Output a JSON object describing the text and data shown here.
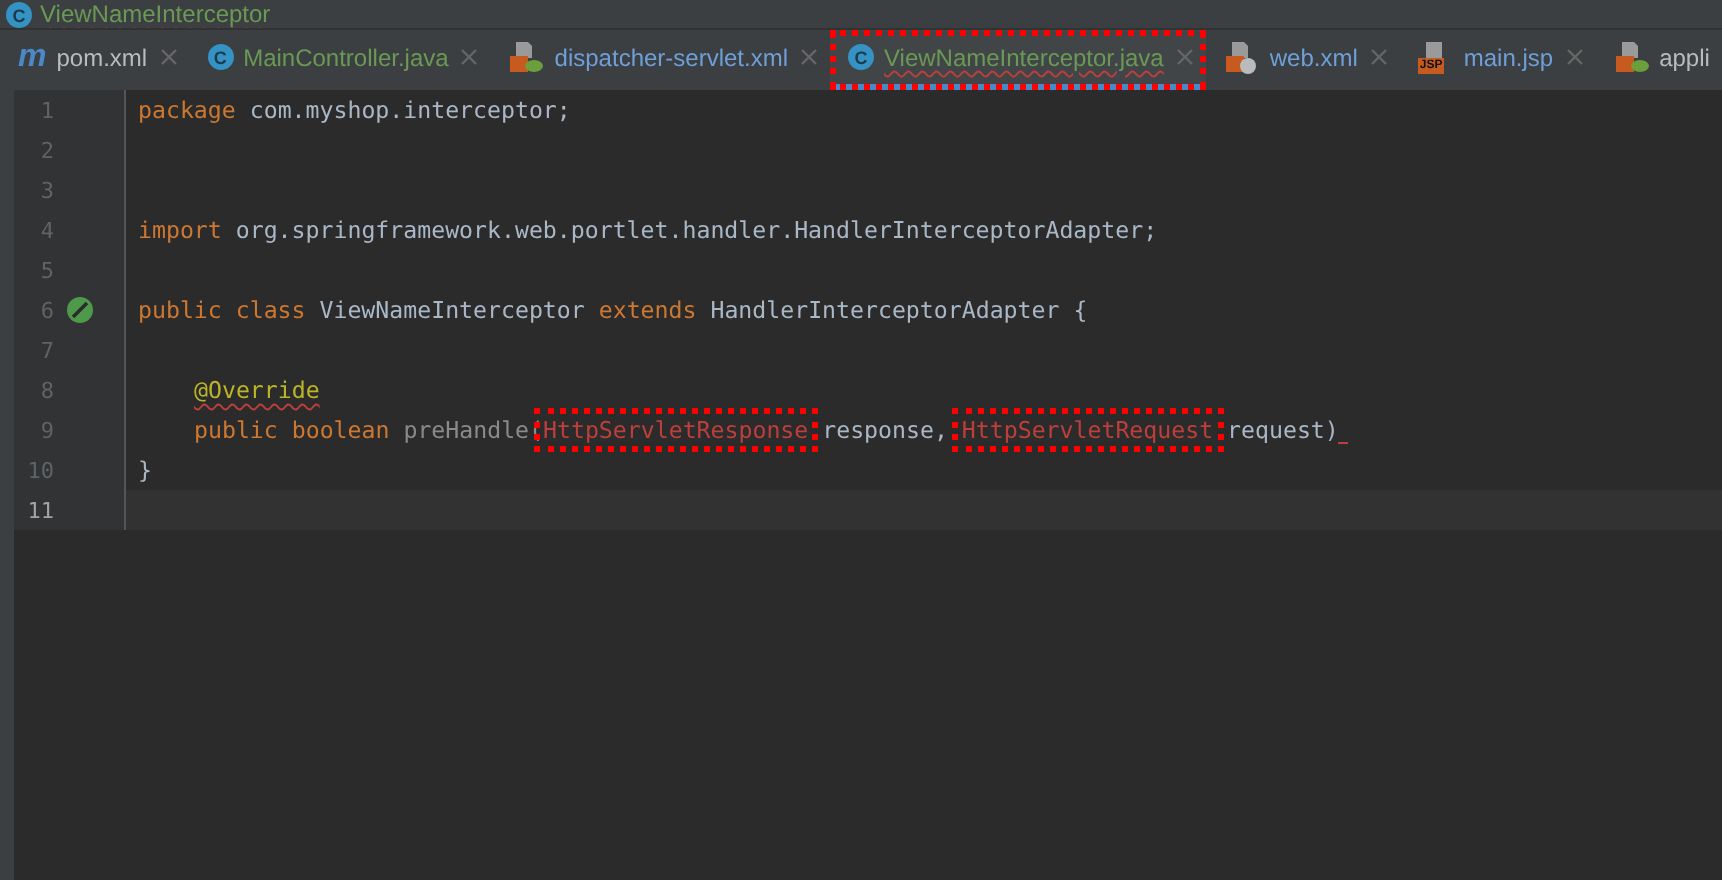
{
  "breadcrumb": {
    "icon_text": "C",
    "title": "ViewNameInterceptor",
    "error": true
  },
  "tabs": [
    {
      "label": "pom.xml",
      "kind": "maven",
      "icon_text": "m",
      "color": "#bbbbbb",
      "selected": false,
      "error": false,
      "highlighted": false
    },
    {
      "label": "MainController.java",
      "kind": "class",
      "icon_text": "C",
      "color": "#6a9955",
      "selected": false,
      "error": false,
      "highlighted": false
    },
    {
      "label": "dispatcher-servlet.xml",
      "kind": "spring",
      "color": "#6f9fd8",
      "selected": false,
      "error": false,
      "highlighted": false
    },
    {
      "label": "ViewNameInterceptor.java",
      "kind": "class",
      "icon_text": "C",
      "color": "#6a9955",
      "selected": true,
      "error": true,
      "highlighted": true
    },
    {
      "label": "web.xml",
      "kind": "web",
      "color": "#6f9fd8",
      "selected": false,
      "error": false,
      "highlighted": false
    },
    {
      "label": "main.jsp",
      "kind": "jsp",
      "icon_text": "JSP",
      "color": "#6f9fd8",
      "selected": false,
      "error": false,
      "highlighted": false
    },
    {
      "label": "appli",
      "kind": "spring",
      "color": "#bbbbbb",
      "selected": false,
      "error": false,
      "highlighted": false
    }
  ],
  "lines": [
    {
      "number": "1",
      "current": false,
      "tokens": [
        {
          "kind": "keyword",
          "text": "package"
        },
        {
          "kind": "plain",
          "text": " com.myshop.interceptor;"
        }
      ]
    },
    {
      "number": "2",
      "current": false
    },
    {
      "number": "3",
      "current": false
    },
    {
      "number": "4",
      "current": false,
      "tokens": [
        {
          "kind": "keyword",
          "text": "import"
        },
        {
          "kind": "plain",
          "text": " org.springframework.web.portlet.handler.HandlerInterceptorAdapter;"
        }
      ]
    },
    {
      "number": "5",
      "current": false
    },
    {
      "number": "6",
      "current": false,
      "gutter": {
        "kind": "implementation"
      },
      "tokens": [
        {
          "kind": "keyword",
          "text": "public class"
        },
        {
          "kind": "plain",
          "text": " ViewNameInterceptor "
        },
        {
          "kind": "keyword",
          "text": "extends"
        },
        {
          "kind": "plain",
          "text": " HandlerInterceptorAdapter {"
        }
      ],
      "children": [
        {
          "number": "7",
          "current": false
        },
        {
          "number": "8",
          "current": false,
          "tokens": [
            {
              "kind": "annotation",
              "text": "@Override",
              "error": true,
              "highlighted": false
            }
          ]
        },
        {
          "number": "9",
          "current": false,
          "tokens": [
            {
              "kind": "keyword",
              "text": "public boolean"
            },
            {
              "kind": "method",
              "text": " preHandle("
            },
            {
              "kind": "error",
              "text": "HttpServletResponse",
              "highlighted": true,
              "error": false
            },
            {
              "kind": "plain",
              "text": " response, "
            },
            {
              "kind": "error",
              "text": "HttpServletRequest",
              "highlighted": true,
              "error": false
            },
            {
              "kind": "plain",
              "text": " request)"
            }
          ],
          "trailing_error": true
        }
      ]
    },
    {
      "number": "10",
      "current": false,
      "tokens": [
        {
          "kind": "plain",
          "text": "}"
        }
      ]
    },
    {
      "number": "11",
      "current": true
    }
  ]
}
